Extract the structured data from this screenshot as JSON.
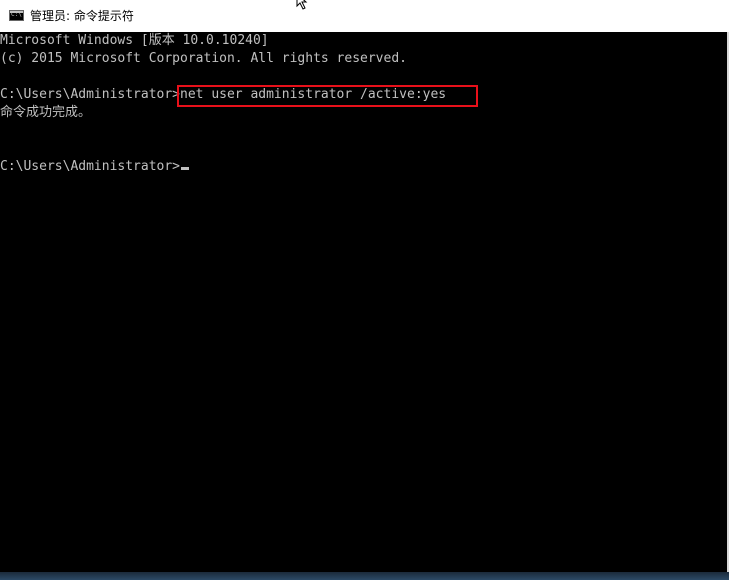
{
  "window": {
    "title": "管理员: 命令提示符",
    "icon": "cmd-prompt-icon",
    "icon_text": "C:\\"
  },
  "console": {
    "lines": [
      "Microsoft Windows [版本 10.0.10240]",
      "(c) 2015 Microsoft Corporation. All rights reserved.",
      "",
      "",
      "命令成功完成。",
      "",
      "",
      ""
    ],
    "prompt1": "C:\\Users\\Administrator>",
    "command": "net user administrator /active:yes",
    "prompt2": "C:\\Users\\Administrator>"
  },
  "colors": {
    "console_bg": "#000000",
    "console_text": "#c0c0c0",
    "highlight_border": "#e8101a"
  }
}
